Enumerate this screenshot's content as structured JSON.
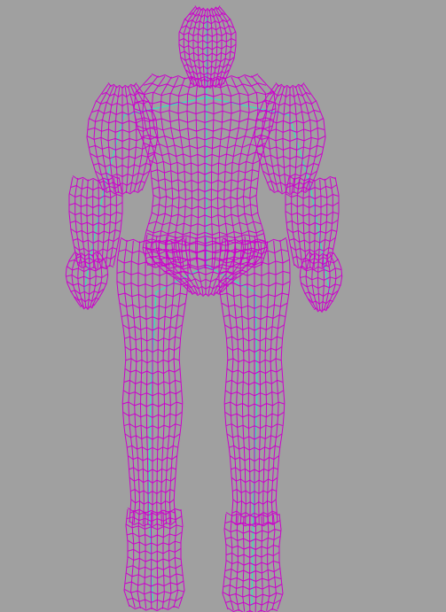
{
  "viewport": {
    "background_color": "#a0a0a0",
    "render_mode": "wireframe",
    "view": "front"
  },
  "model": {
    "kind": "armored humanoid character",
    "wire_color": "#cc00cc",
    "skeleton_color": "#33e0c0",
    "parts": [
      "helmet",
      "torso",
      "left-shoulder-pad",
      "right-shoulder-pad",
      "left-arm",
      "right-arm",
      "left-hand",
      "right-hand",
      "pelvis",
      "left-leg",
      "right-leg",
      "left-boot",
      "right-boot"
    ]
  }
}
